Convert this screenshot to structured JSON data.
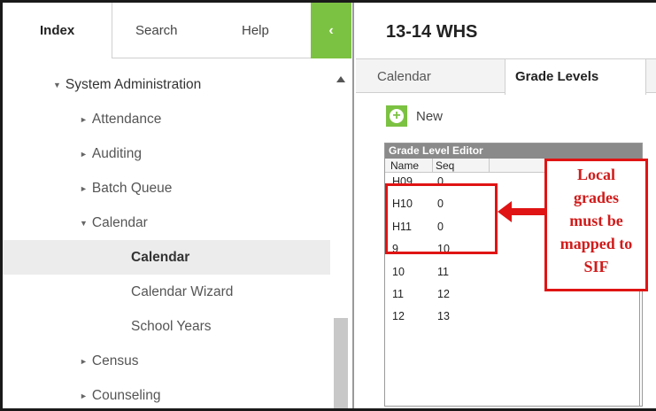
{
  "nav": {
    "tabs": [
      {
        "label": "Index"
      },
      {
        "label": "Search"
      },
      {
        "label": "Help"
      }
    ],
    "collapse_glyph": "‹"
  },
  "tree": {
    "items": [
      {
        "label": "System Administration",
        "expanded": true
      },
      {
        "label": "Attendance"
      },
      {
        "label": "Auditing"
      },
      {
        "label": "Batch Queue"
      },
      {
        "label": "Calendar",
        "expanded": true
      },
      {
        "label": "Calendar",
        "selected": true
      },
      {
        "label": "Calendar Wizard"
      },
      {
        "label": "School Years"
      },
      {
        "label": "Census"
      },
      {
        "label": "Counseling"
      }
    ]
  },
  "page": {
    "title": "13-14 WHS",
    "tabs": [
      {
        "label": "Calendar"
      },
      {
        "label": "Grade Levels",
        "active": true
      }
    ],
    "new_label": "New"
  },
  "editor": {
    "title": "Grade Level Editor",
    "columns": [
      "Name",
      "Seq"
    ],
    "rows": [
      {
        "name": "H09",
        "seq": "0"
      },
      {
        "name": "H10",
        "seq": "0"
      },
      {
        "name": "H11",
        "seq": "0"
      },
      {
        "name": "9",
        "seq": "10"
      },
      {
        "name": "10",
        "seq": "11"
      },
      {
        "name": "11",
        "seq": "12"
      },
      {
        "name": "12",
        "seq": "13"
      }
    ]
  },
  "annotation": {
    "lines": [
      "Local",
      "grades",
      "must be",
      "mapped to",
      "SIF"
    ],
    "color": "#e01414"
  },
  "colors": {
    "accent": "#7cc242",
    "header_gray": "#8a8a8a"
  }
}
